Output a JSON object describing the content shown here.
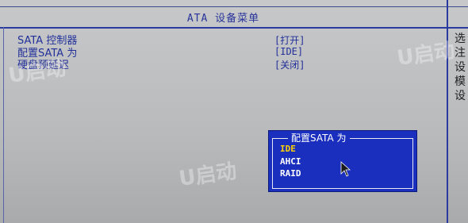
{
  "header": {
    "title": "ATA 设备菜单"
  },
  "menu": {
    "items": [
      {
        "label": "SATA 控制器",
        "value": "[打开]"
      },
      {
        "label": "配置SATA 为",
        "value": "[IDE]"
      },
      {
        "label": "硬盘预延迟",
        "value": "[关闭]"
      }
    ]
  },
  "help_panel": {
    "chars": [
      "选",
      "注",
      "设",
      "模",
      "设"
    ]
  },
  "popup": {
    "title": "配置SATA 为",
    "options": [
      "IDE",
      "AHCI",
      "RAID"
    ],
    "selected": "IDE"
  },
  "watermark": {
    "text": "U启动"
  },
  "colors": {
    "text_blue": "#22309a",
    "popup_bg": "#1b2fbf",
    "selected_option": "#ffd200"
  }
}
